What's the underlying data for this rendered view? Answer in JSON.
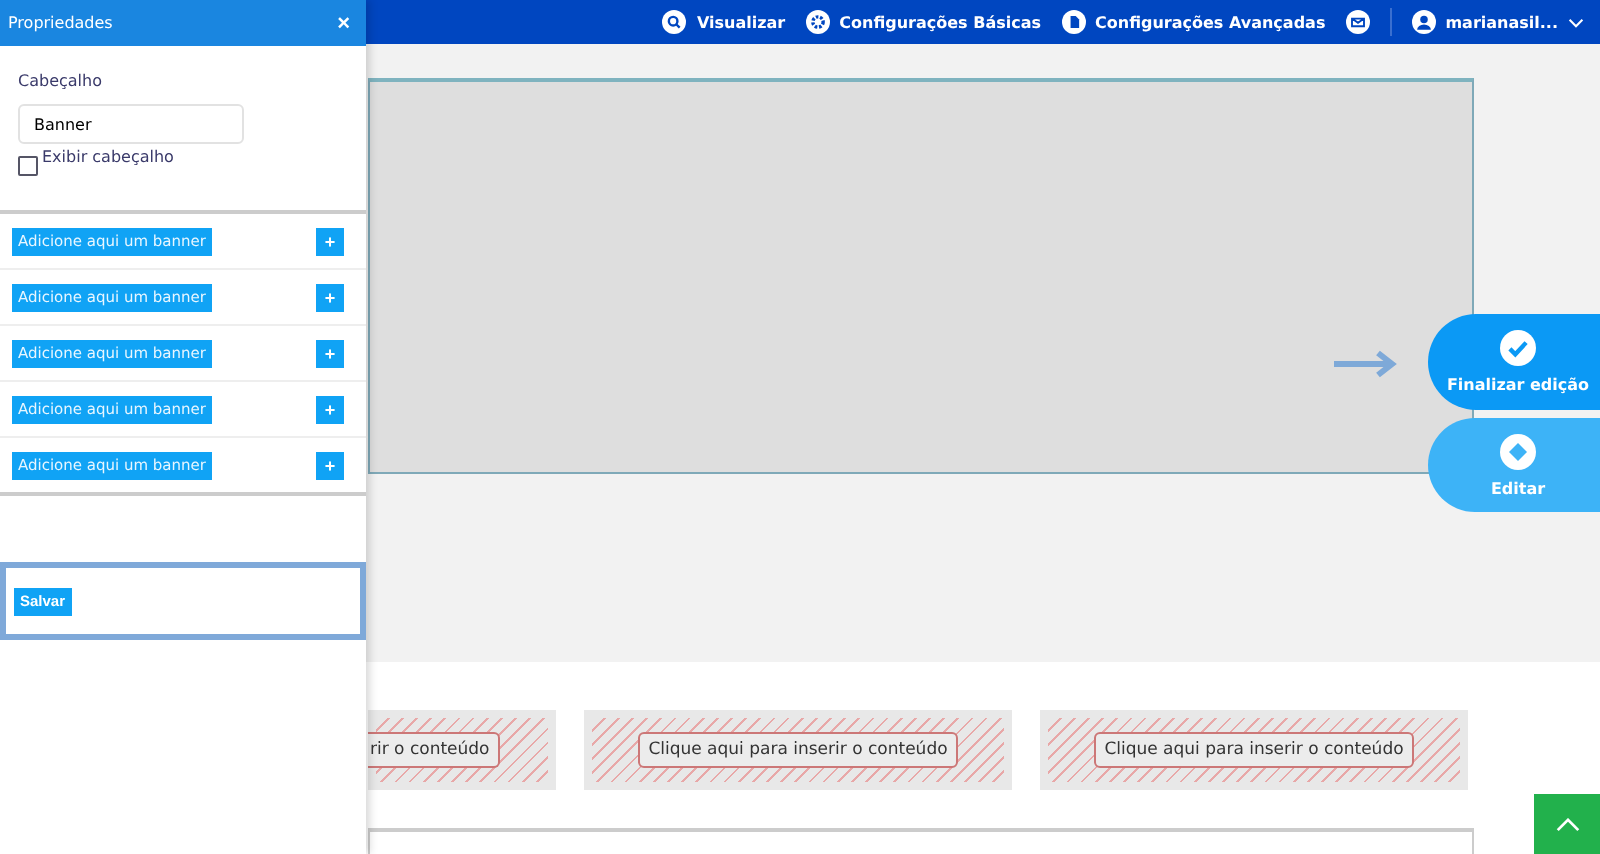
{
  "topbar": {
    "nav": [
      {
        "label": "Visualizar"
      },
      {
        "label": "Configurações Básicas"
      },
      {
        "label": "Configurações Avançadas"
      }
    ],
    "user": "marianasil..."
  },
  "floating": {
    "finish": "Finalizar edição",
    "edit": "Editar"
  },
  "content_slots": [
    {
      "label": "rir o conteúdo"
    },
    {
      "label": "Clique aqui para inserir o conteúdo"
    },
    {
      "label": "Clique aqui para inserir o conteúdo"
    }
  ],
  "panel": {
    "title": "Propriedades",
    "close": "×",
    "heading_label": "Cabeçalho",
    "heading_value": "Banner",
    "show_heading": {
      "label": "Exibir cabeçalho",
      "checked": false
    },
    "banner_rows": [
      {
        "label": "Adicione aqui um banner",
        "add": "+"
      },
      {
        "label": "Adicione aqui um banner",
        "add": "+"
      },
      {
        "label": "Adicione aqui um banner",
        "add": "+"
      },
      {
        "label": "Adicione aqui um banner",
        "add": "+"
      },
      {
        "label": "Adicione aqui um banner",
        "add": "+"
      }
    ],
    "save": "Salvar"
  }
}
